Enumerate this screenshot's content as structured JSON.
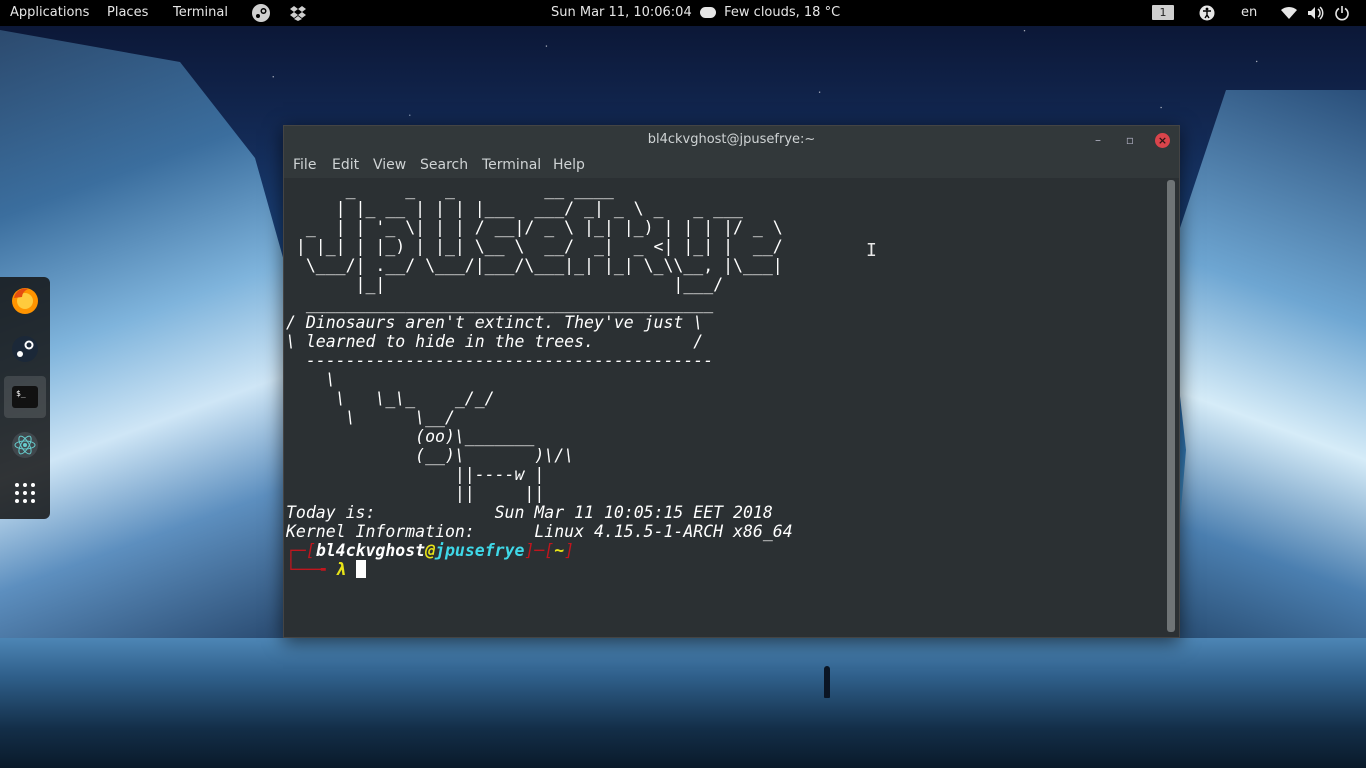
{
  "topbar": {
    "applications": "Applications",
    "places": "Places",
    "terminal": "Terminal",
    "datetime": "Sun Mar 11, 10:06:04",
    "weather": "Few clouds, 18 °C",
    "workspace": "1",
    "lang": "en",
    "icons": [
      "steam-icon",
      "dropbox-icon",
      "weather-icon",
      "accessibility-icon",
      "wifi-icon",
      "volume-icon",
      "power-icon"
    ]
  },
  "dock": {
    "items": [
      "firefox-icon",
      "steam-icon",
      "terminal-icon",
      "atom-icon",
      "app-grid-icon"
    ]
  },
  "window": {
    "title": "bl4ckvghost@jpusefrye:~",
    "menu": [
      "File",
      "Edit",
      "View",
      "Search",
      "Terminal",
      "Help"
    ],
    "ascii_banner": "      _     _   _         __ ____\n     | |_ __ | | | |___  ___/ _| _ \\ _   _ ___\n  _  | | '_ \\| | | / __|/ _ \\ |_| |_) | | | |/ _ \\\n | |_| | |_) | |_| \\__ \\  __/  _|  _ <| |_| |  __/\n  \\___/| .__/ \\___/|___/\\___|_| |_| \\_\\\\__, |\\___|\n       |_|                             |___/",
    "cowsay": "  _________________________________________\n/ Dinosaurs aren't extinct. They've just \\\n\\ learned to hide in the trees.          /\n  -----------------------------------------\n    \\\n     \\   \\_\\_    _/_/\n      \\      \\__/\n             (oo)\\_______\n             (__)\\       )\\/\\\n                 ||----w |\n                 ||     ||",
    "today_label": "Today is:",
    "today_value": "Sun Mar 11 10:05:15 EET 2018",
    "kernel_label": "Kernel Information:",
    "kernel_value": "Linux 4.15.5-1-ARCH x86_64",
    "prompt": {
      "open": "┌─[",
      "user": "bl4ckvghost",
      "at": "@",
      "host": "jpusefrye",
      "close": "]─[",
      "path": "~",
      "end": "]",
      "line2": "└──╼ ",
      "lambda": "λ"
    }
  },
  "colors": {
    "terminal_bg": "#2b3033",
    "prompt_red": "#c0161e",
    "prompt_yellow": "#e7e318",
    "prompt_cyan": "#3fd8e8",
    "close_button": "#d9444b"
  }
}
